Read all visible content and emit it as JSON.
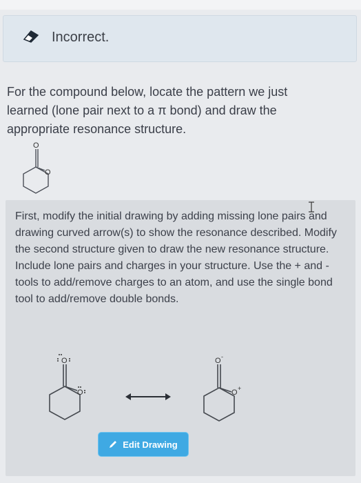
{
  "banner": {
    "status": "Incorrect."
  },
  "question": {
    "text": "For the compound below, locate the pattern we just learned (lone pair next to a π bond) and draw the appropriate resonance structure."
  },
  "instructions": {
    "text": "First, modify the initial drawing by adding missing lone pairs and drawing curved arrow(s) to show the resonance described. Modify the second structure given to draw the new resonance structure. Include lone pairs and charges in your structure. Use the + and - tools to add/remove charges to an atom, and use the single bond tool to add/remove double bonds."
  },
  "molecules": {
    "atom_label": "O",
    "charge_minus": "-",
    "charge_plus": "+"
  },
  "edit_button": {
    "label": "Edit Drawing"
  },
  "colors": {
    "accent": "#3fa9e3",
    "banner_bg": "#dfe7ee",
    "panel_bg": "#d9dce0"
  }
}
